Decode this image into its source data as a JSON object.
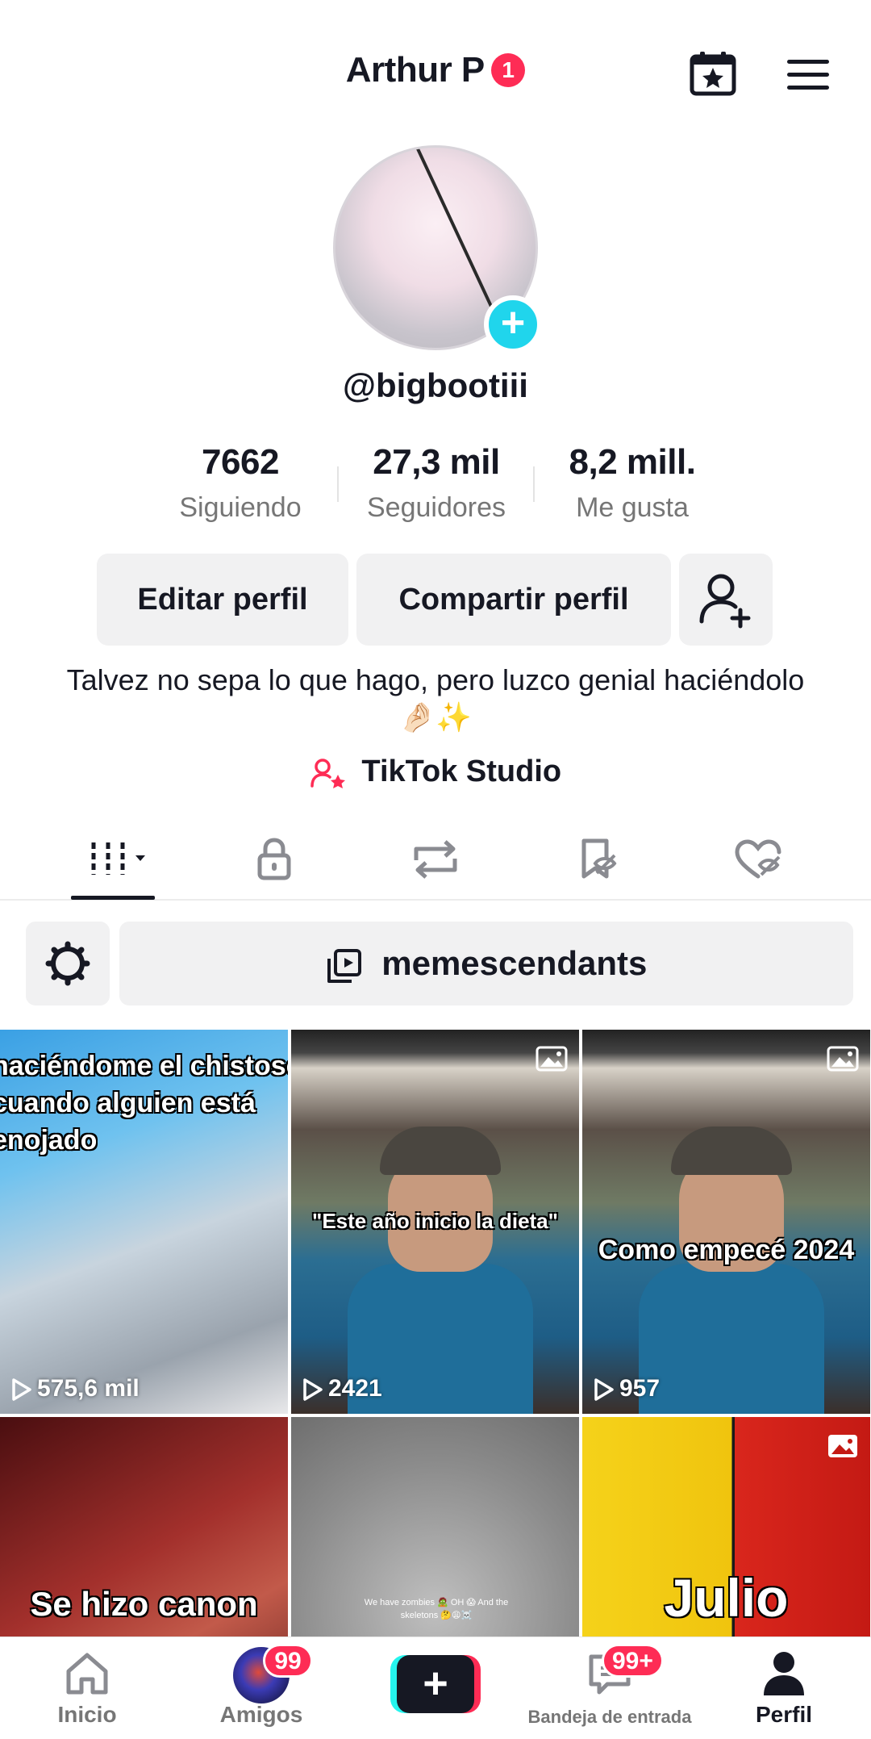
{
  "header": {
    "title": "Arthur P",
    "title_badge": "1"
  },
  "profile": {
    "username": "@bigbootiii",
    "stats": [
      {
        "value": "7662",
        "label": "Siguiendo"
      },
      {
        "value": "27,3 mil",
        "label": "Seguidores"
      },
      {
        "value": "8,2 mill.",
        "label": "Me gusta"
      }
    ],
    "edit_label": "Editar perfil",
    "share_label": "Compartir perfil",
    "bio": "Talvez no sepa lo que hago, pero luzco genial haciéndolo 🤌🏻✨",
    "studio_label": "TikTok Studio"
  },
  "collection": {
    "name": "memescendants"
  },
  "grid": [
    {
      "caption": "haciéndome el chistoso cuando alguien está enojado",
      "views": "575,6 mil"
    },
    {
      "caption": "\"Este año inicio la dieta\"",
      "views": "2421"
    },
    {
      "caption": "Como empecé 2024",
      "views": "957"
    },
    {
      "caption": "Se hizo canon",
      "views": ""
    },
    {
      "caption": "We have zombies 🧟 OH 😱 And the skeletons 🤔😩☠️",
      "views": ""
    },
    {
      "caption": "Julio",
      "views": ""
    }
  ],
  "nav": {
    "home": "Inicio",
    "friends": "Amigos",
    "friends_badge": "99",
    "inbox": "Bandeja de entrada",
    "inbox_badge": "99+",
    "profile": "Perfil"
  },
  "colors": {
    "accent": "#fe2c55",
    "cyan": "#20d5ec",
    "text": "#161823",
    "muted": "#767676",
    "button_bg": "#f1f1f2"
  }
}
